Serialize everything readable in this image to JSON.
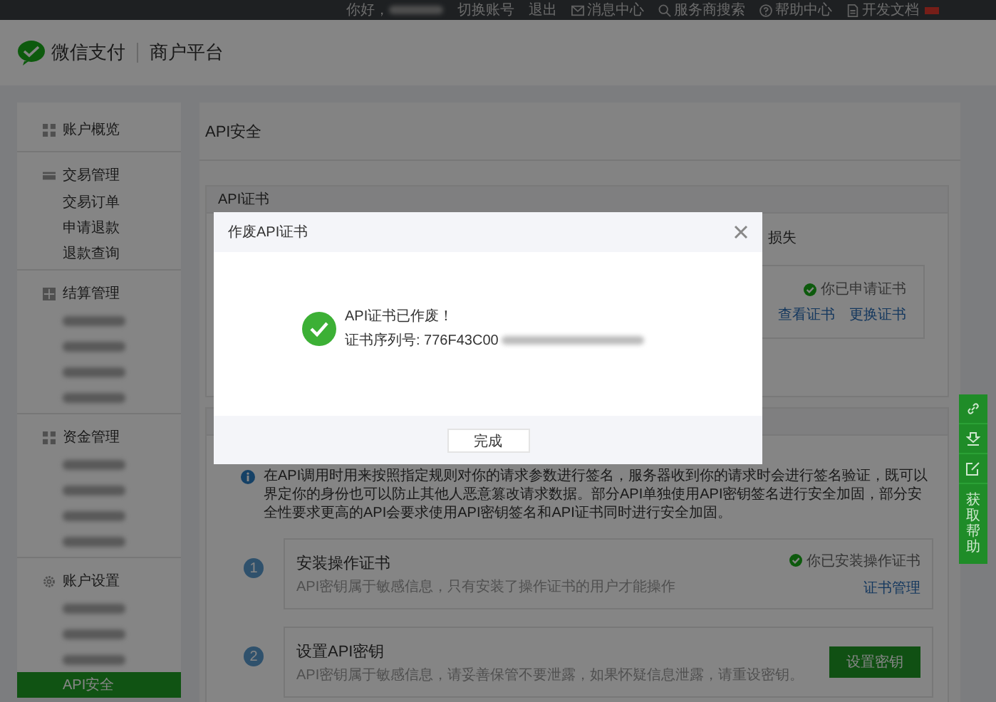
{
  "top_bar": {
    "greeting": "你好，",
    "account_redacted": true,
    "links": [
      {
        "kind": "text",
        "label": "切换账号"
      },
      {
        "kind": "text",
        "label": "退出"
      },
      {
        "kind": "mail",
        "label": "消息中心"
      },
      {
        "kind": "search",
        "label": "服务商搜索"
      },
      {
        "kind": "help",
        "label": "帮助中心"
      },
      {
        "kind": "doc",
        "label": "开发文档",
        "badge": true
      }
    ]
  },
  "brand": {
    "name": "微信支付",
    "product": "商户平台"
  },
  "sidebar": {
    "groups": [
      {
        "title": "账户概览"
      },
      {
        "title": "交易管理",
        "items": [
          {
            "kind": "text",
            "label": "交易订单",
            "selected": false
          },
          {
            "kind": "text",
            "label": "申请退款",
            "selected": false
          },
          {
            "kind": "text",
            "label": "退款查询",
            "selected": false
          }
        ]
      },
      {
        "title": "结算管理",
        "items": [
          {
            "kind": "redacted",
            "selected": false
          },
          {
            "kind": "redacted",
            "selected": false
          },
          {
            "kind": "redacted",
            "selected": false
          },
          {
            "kind": "redacted",
            "selected": false
          }
        ]
      },
      {
        "title": "资金管理",
        "items": [
          {
            "kind": "redacted",
            "selected": false
          },
          {
            "kind": "redacted",
            "selected": false
          },
          {
            "kind": "redacted",
            "selected": false
          },
          {
            "kind": "redacted",
            "selected": false
          }
        ]
      },
      {
        "title": "账户设置",
        "items": [
          {
            "kind": "redacted",
            "selected": false
          },
          {
            "kind": "redacted",
            "selected": false
          },
          {
            "kind": "redacted",
            "selected": false
          },
          {
            "kind": "text",
            "label": "API安全",
            "selected": true
          }
        ]
      }
    ]
  },
  "page": {
    "title": "API安全",
    "cert_section": {
      "title": "API证书",
      "description_visible": "损失",
      "status": "你已申请证书",
      "links": [
        "查看证书",
        "更换证书"
      ]
    },
    "key_section": {
      "info": "在API调用时用来按照指定规则对你的请求参数进行签名，服务器收到你的请求时会进行签名验证，既可以界定你的身份也可以防止其他人恶意篡改请求数据。部分API单独使用API密钥签名进行安全加固，部分安全性要求更高的API会要求使用API密钥签名和API证书同时进行安全加固。",
      "steps": [
        {
          "number": "1",
          "title": "安装操作证书",
          "description": "API密钥属于敏感信息，只有安装了操作证书的用户才能操作",
          "status": "你已安装操作证书",
          "link": "证书管理"
        },
        {
          "number": "2",
          "title": "设置API密钥",
          "description": "API密钥属于敏感信息，请妥善保管不要泄露，如果怀疑信息泄露，请重设密钥。",
          "button": "设置密钥"
        }
      ]
    }
  },
  "modal": {
    "title": "作废API证书",
    "message": "API证书已作废！",
    "serial_label": "证书序列号: 776F43C00",
    "serial_redacted": true,
    "button": "完成"
  },
  "help_bar": {
    "label": "获取帮助"
  }
}
